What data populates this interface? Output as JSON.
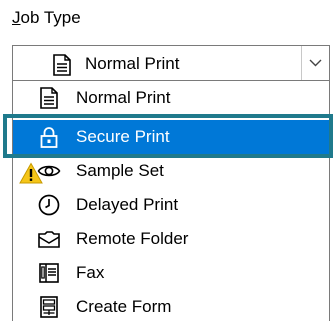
{
  "job_type": {
    "label": "Job Type",
    "label_accelerator": "J",
    "label_rest": "ob Type",
    "selected_value": "Normal Print",
    "selected_icon": "document-icon",
    "dropdown_button_icon": "chevron-down-icon",
    "options": [
      {
        "label": "Normal Print",
        "icon": "document-icon",
        "selected": false
      },
      {
        "label": "Secure Print",
        "icon": "lock-icon",
        "selected": true
      },
      {
        "label": "Sample Set",
        "icon": "eye-icon",
        "selected": false
      },
      {
        "label": "Delayed Print",
        "icon": "clock-icon",
        "selected": false
      },
      {
        "label": "Remote Folder",
        "icon": "folder-icon",
        "selected": false
      },
      {
        "label": "Fax",
        "icon": "fax-icon",
        "selected": false
      },
      {
        "label": "Create Form",
        "icon": "form-icon",
        "selected": false
      }
    ]
  },
  "colors": {
    "selection": "#0078d7",
    "highlight_frame": "#1f7a8c",
    "warning_fill": "#f5c518"
  },
  "warning_icon": "warning-icon"
}
